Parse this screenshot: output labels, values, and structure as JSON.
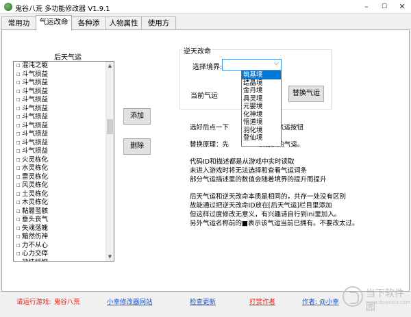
{
  "window": {
    "title": "鬼谷八荒 多功能修改器  V1.9.1",
    "minimize": "–",
    "maximize": "☐",
    "close": "✕"
  },
  "tabs": [
    "常用功能",
    "气运改命",
    "各种添加",
    "人物属性",
    "使用方法"
  ],
  "left_panel": {
    "title": "后天气运",
    "items": [
      "混沌之躯",
      "斗气损益",
      "斗气损益",
      "斗气损益",
      "斗气损益",
      "斗气损益",
      "斗气损益",
      "斗气损益",
      "斗气损益",
      "斗气损益",
      "斗气损益",
      "火灵栋化",
      "水灵栋化",
      "雷灵栋化",
      "风灵栋化",
      "土灵栋化",
      "木灵栋化",
      "黏履茧骸",
      "垂头丧气",
      "失魂落魄",
      "黯然伤神",
      "力不从心",
      "心力交瘁",
      "神情恍惚"
    ]
  },
  "buttons": {
    "add": "添加",
    "delete": "删除",
    "replace": "替换气运"
  },
  "fate_group": {
    "title": "逆天改命",
    "realm_label": "选择境界:",
    "current_label": "当前气运",
    "realm_options": [
      "筑基境",
      "结晶境",
      "金丹境",
      "具灵境",
      "元婴境",
      "化神境",
      "悟道境",
      "羽化境",
      "登仙境"
    ]
  },
  "info": {
    "line1_a": "选好后点一下",
    "line1_b": "替换气运",
    "line1_c": "按钮",
    "line2_a": "替换原理：先",
    "line2_b": "被替换的气运。",
    "line3": "代码ID和描述都是从游戏中实时读取",
    "line4": "未进入游戏时将无法选择和查看气运词条",
    "line5": "部分气运描述里的数值会随着境界的提升而提升",
    "line6": "后天气运和逆天改命本质是相同的，共存一处没有区别",
    "line7": "故能通过把逆天改命ID放在[后天气运]栏目里添加",
    "line8": "但这样过度修改无意义，有兴趣请自行到ini里加入。",
    "line9": "另外气运名称前的■表示该气运当前已拥有。不要改太过。"
  },
  "footer": {
    "launch": "请运行游戏:",
    "game": "鬼谷八荒",
    "site": "小幸修改器网站",
    "update": "检查更新",
    "donate": "打赏作者",
    "author": "作者: @小幸"
  },
  "watermark": {
    "text": "当下软件园",
    "sub": "www.downxia.com"
  },
  "icons": {
    "list_checkbox": "small-square-icon",
    "dropdown_arrow": "chevron-down-icon",
    "scroll_up": "triangle-up-icon",
    "scroll_down": "triangle-down-icon"
  },
  "colors": {
    "accent": "#0078d7",
    "footer_red": "#e0241c",
    "footer_link": "#1a52cc"
  }
}
